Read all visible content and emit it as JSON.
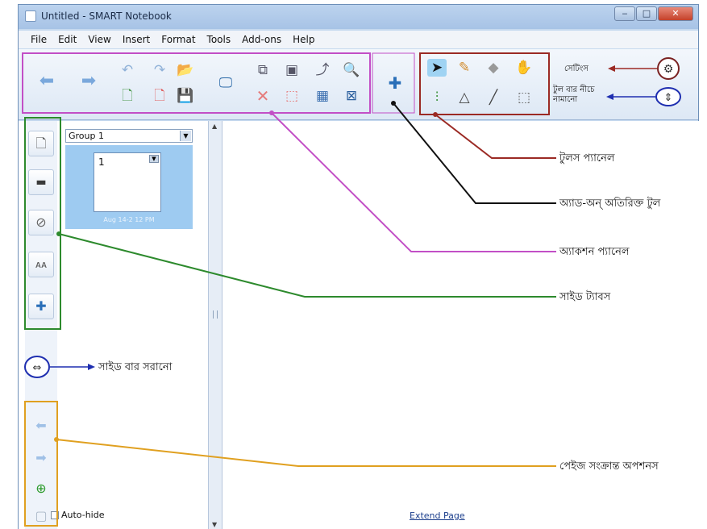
{
  "window": {
    "title": "Untitled - SMART Notebook",
    "controls": {
      "minimize": "‒",
      "maximize": "□",
      "close": "✕"
    }
  },
  "menubar": {
    "items": [
      "File",
      "Edit",
      "View",
      "Insert",
      "Format",
      "Tools",
      "Add-ons",
      "Help"
    ]
  },
  "toolbar": {
    "action_icons": [
      "back-arrow-icon",
      "forward-arrow-icon",
      "undo-icon",
      "redo-icon",
      "open-file-icon",
      "new-page-icon",
      "delete-page-icon",
      "save-icon",
      "screen-shade-icon",
      "screen-capture-icon",
      "insert-image-icon",
      "rotate-icon",
      "zoom-icon",
      "delete-icon",
      "table-icon",
      "full-screen-icon"
    ],
    "addon_icon": "puzzle-icon",
    "tool_icons": [
      "select-arrow-icon",
      "pen-icon",
      "eraser-icon",
      "magic-pen-icon",
      "creative-pen-icon",
      "shape-icon",
      "line-icon",
      "fill-icon"
    ],
    "settings_icon": "gear-icon",
    "move-toolbar-icon": "updown-arrow-icon"
  },
  "sidebar": {
    "tabs": [
      "page-sorter-icon",
      "gallery-icon",
      "attachments-icon",
      "properties-icon",
      "addons-tab-icon"
    ],
    "group_select": "Group 1",
    "page_thumbnail": {
      "number": "1",
      "caption": "Aug 14-2 12 PM"
    },
    "autohide_label": "Auto-hide",
    "page_options_icons": [
      "prev-page-icon",
      "next-page-icon",
      "add-page-icon",
      "page-options-icon"
    ]
  },
  "canvas": {
    "extend_page": "Extend Page"
  },
  "annotations": {
    "settings": "সেটিংস",
    "toolbar_move": "টুল বার নীচে নামানো",
    "tools_panel": "টুলস প্যানেল",
    "addons": "অ্যাড-অন্ অতিরিক্ত টুল",
    "actions_panel": "অ্যাকশন প্যানেল",
    "side_tabs": "সাইড ট্যাবস",
    "move_sidebar": "সাইড বার সরানো",
    "page_options": "পেইজ সংক্রান্ত অপশনস"
  },
  "colors": {
    "actions_box": "#c24fc6",
    "tools_box": "#9b2a24",
    "addon_line": "#111111",
    "sidetabs_box": "#2d8a2d",
    "move_circle": "#1f2fb0",
    "pageopts_box": "#e0a020",
    "settings_circle": "#7a2222"
  }
}
